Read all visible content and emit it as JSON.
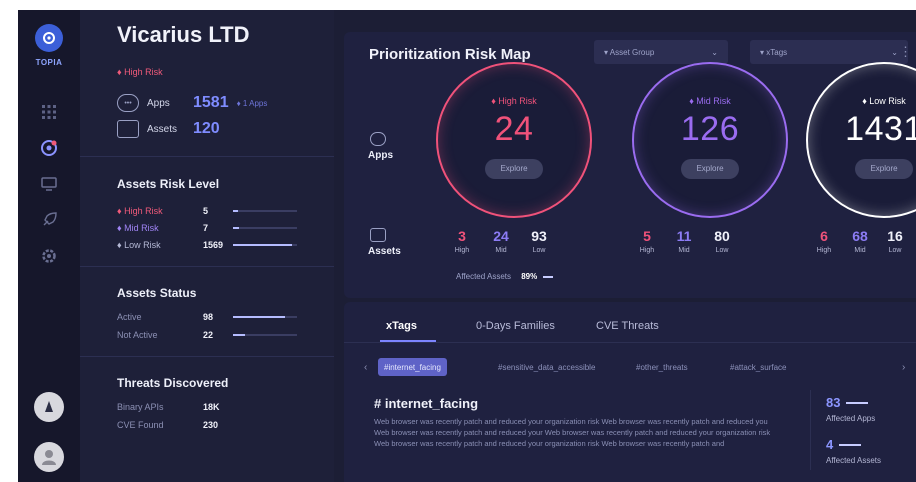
{
  "rail": {
    "logo_text": "TOPIA",
    "icons": [
      "grid-icon",
      "target-icon",
      "monitor-icon",
      "rocket-icon",
      "settings-icon"
    ]
  },
  "account": {
    "title": "Vicarius LTD",
    "risk_tag": "♦ High Risk",
    "apps_label": "Apps",
    "apps_value": "1581",
    "apps_sub": "♦ 1 Apps",
    "assets_label": "Assets",
    "assets_value": "120"
  },
  "risk_level": {
    "title": "Assets Risk Level",
    "rows": [
      {
        "label": "♦ High Risk",
        "value": "5",
        "color": "#f05a7a",
        "fraction": 0.08
      },
      {
        "label": "♦ Mid Risk",
        "value": "7",
        "color": "#a084f5",
        "fraction": 0.1
      },
      {
        "label": "♦ Low Risk",
        "value": "1569",
        "color": "#ffffff",
        "fraction": 0.92
      }
    ]
  },
  "status": {
    "title": "Assets Status",
    "rows": [
      {
        "label": "Active",
        "value": "98",
        "fraction": 0.82
      },
      {
        "label": "Not Active",
        "value": "22",
        "fraction": 0.18
      }
    ]
  },
  "threats": {
    "title": "Threats Discovered",
    "rows": [
      {
        "label": "Binary APIs",
        "value": "18K"
      },
      {
        "label": "CVE Found",
        "value": "230"
      }
    ]
  },
  "map": {
    "title": "Prioritization Risk Map",
    "dropdown_group": "▾  Asset Group",
    "dropdown_tags": "▾  xTags",
    "apps_label": "Apps",
    "assets_label": "Assets",
    "explore": "Explore",
    "rings": [
      {
        "label": "♦ High Risk",
        "value": "24",
        "color": "#f0527a",
        "assets": [
          "3",
          "24",
          "93"
        ]
      },
      {
        "label": "♦ Mid Risk",
        "value": "126",
        "color": "#9a6cf0",
        "assets": [
          "5",
          "11",
          "80"
        ]
      },
      {
        "label": "♦ Low Risk",
        "value": "1431",
        "color": "#ffffff",
        "assets": [
          "6",
          "68",
          "16"
        ]
      }
    ],
    "asset_cols": [
      "High",
      "Mid",
      "Low"
    ],
    "affected_label": "Affected Assets",
    "affected_value": "89%"
  },
  "tags_panel": {
    "tabs": [
      "xTags",
      "0-Days Families",
      "CVE Threats"
    ],
    "chips": [
      "#internet_facing",
      "#sensitive_data_accessible",
      "#other_threats",
      "#attack_surface"
    ],
    "tag_title": "# internet_facing",
    "tag_desc": "Web browser was recently patch and reduced your organization risk Web browser was recently patch and reduced you Web browser was recently patch and reduced your Web browser was recently patch and reduced your organization risk Web browser was recently patch and reduced your organization risk Web browser was recently patch and",
    "apps_count": "83",
    "apps_label": "Affected Apps",
    "assets_count": "4",
    "assets_label": "Affected Assets"
  }
}
